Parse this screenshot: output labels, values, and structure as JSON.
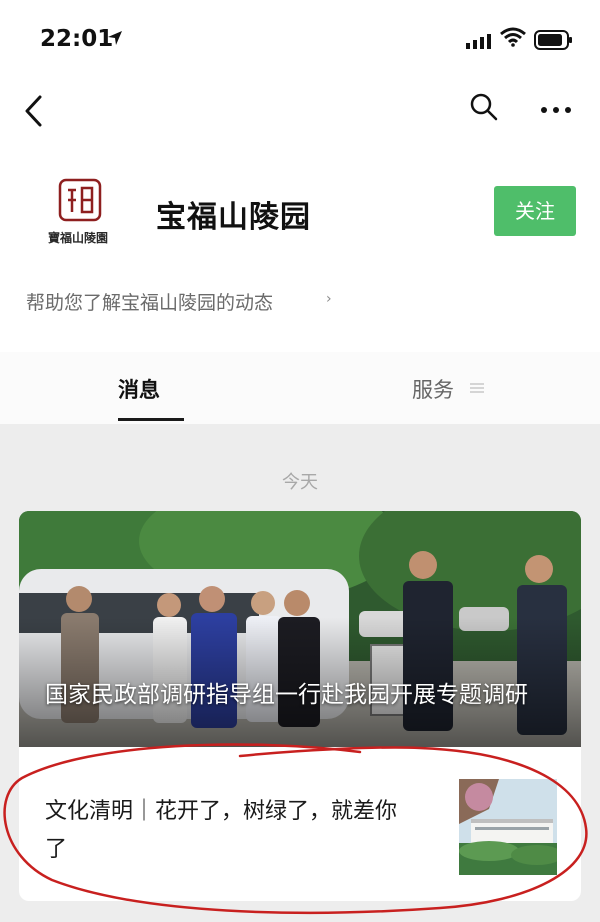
{
  "status_bar": {
    "time": "22:01"
  },
  "account": {
    "name": "宝福山陵园",
    "logo_text": "寶福山陵園",
    "follow_label": "关注",
    "intro": "帮助您了解宝福山陵园的动态",
    "intro_chevron": "›"
  },
  "tabs": [
    {
      "label": "消息",
      "active": true
    },
    {
      "label": "服务",
      "active": false
    }
  ],
  "feed": {
    "date_label": "今天",
    "cover_title": "国家民政部调研指导组一行赴我园开展专题调研",
    "item_title": "文化清明｜花开了，树绿了，就差你了"
  },
  "colors": {
    "follow_button": "#4fbe6a",
    "page_bg": "#ededed",
    "annotation": "#c8201f"
  },
  "icons": [
    "location-arrow-icon",
    "signal-icon",
    "wifi-icon",
    "battery-icon",
    "back-icon",
    "search-icon",
    "more-icon",
    "menu-lines-icon"
  ]
}
